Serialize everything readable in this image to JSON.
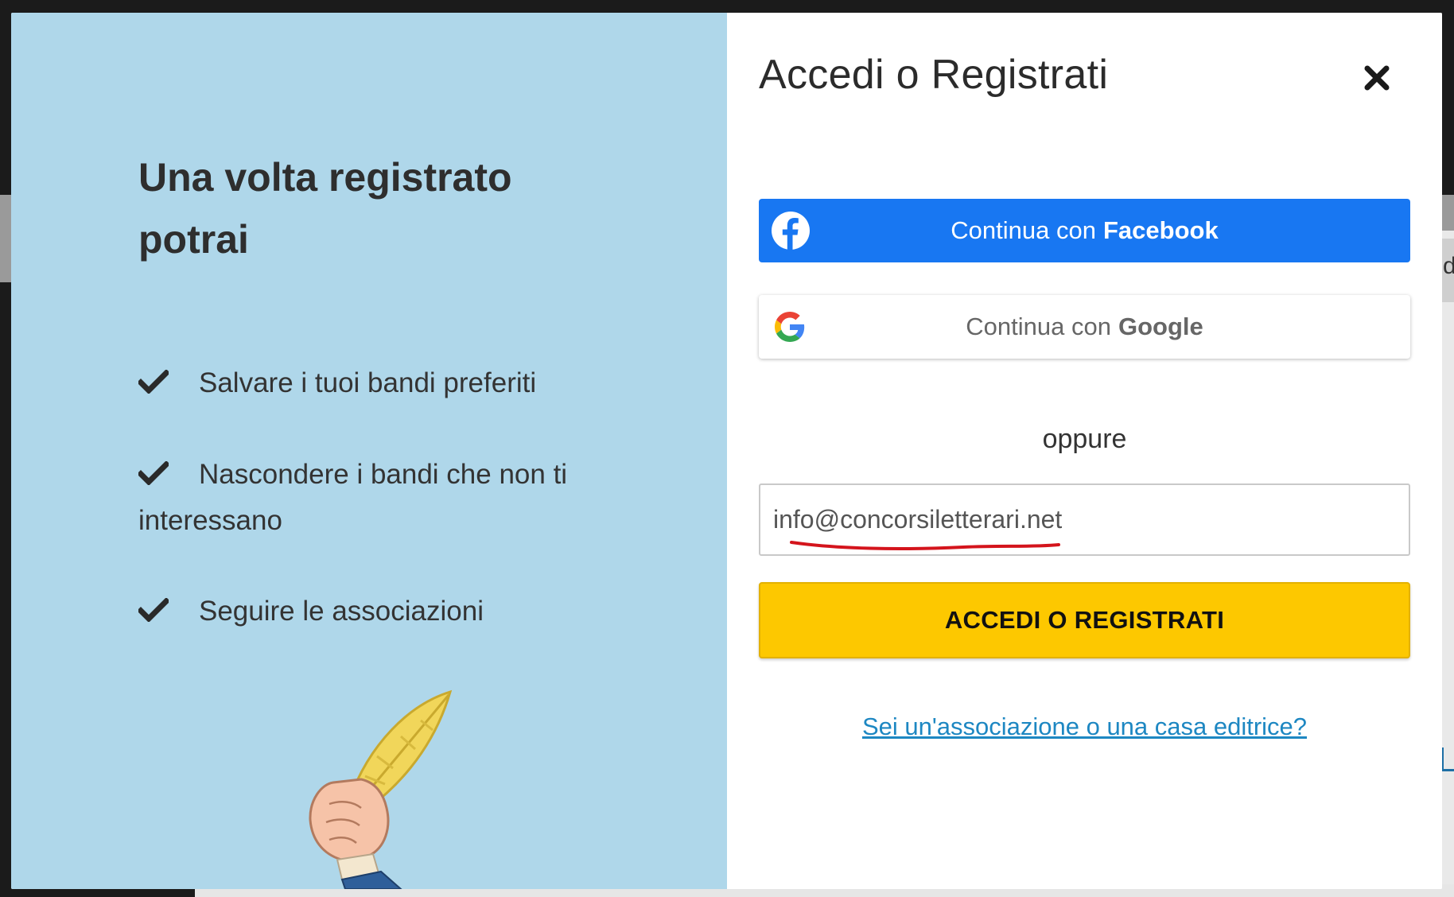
{
  "left_panel": {
    "heading": "Una volta registrato potrai",
    "benefits": [
      "Salvare i tuoi bandi preferiti",
      "Nascondere i bandi che non ti interessano",
      "Seguire le associazioni"
    ],
    "background_color": "#afd7ea"
  },
  "right_panel": {
    "title": "Accedi o Registrati",
    "facebook_button": {
      "prefix": "Continua con",
      "brand": "Facebook",
      "color": "#1877f2"
    },
    "google_button": {
      "prefix": "Continua con",
      "brand": "Google"
    },
    "separator": "oppure",
    "email_input": {
      "value": "info@concorsiletterari.net"
    },
    "submit_label": "ACCEDI O REGISTRATI",
    "submit_color": "#fdc800",
    "association_link": "Sei un'associazione o una casa editrice?"
  },
  "icons": [
    "close-icon",
    "facebook-icon",
    "google-icon",
    "check-icon",
    "quill-illustration"
  ]
}
